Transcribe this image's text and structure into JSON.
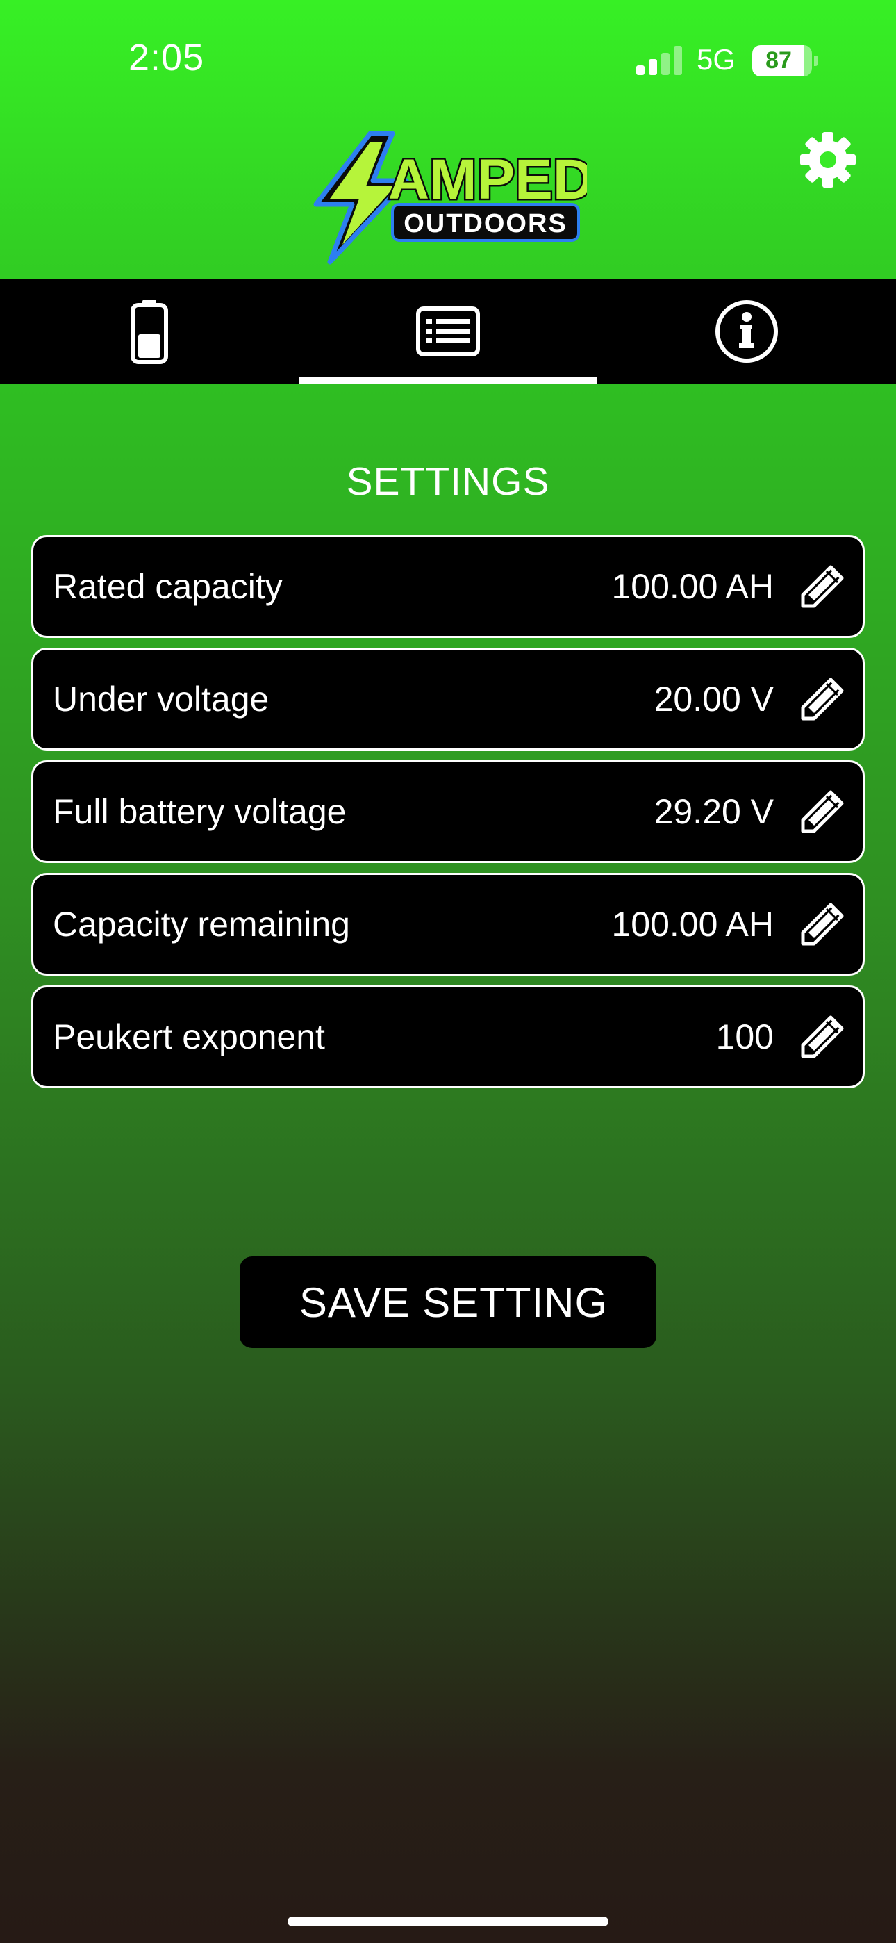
{
  "status_bar": {
    "time": "2:05",
    "network": "5G",
    "battery_percent": "87",
    "battery_level": 0.87,
    "signal_bars_active": 2,
    "signal_bars_total": 4
  },
  "header": {
    "logo_primary": "AMPED",
    "logo_secondary": "OUTDOORS",
    "settings_icon": "gear-icon"
  },
  "tabs": [
    {
      "icon": "battery-icon",
      "active": false
    },
    {
      "icon": "list-icon",
      "active": true
    },
    {
      "icon": "info-icon",
      "active": false
    }
  ],
  "page": {
    "title": "SETTINGS"
  },
  "settings": [
    {
      "label": "Rated capacity",
      "value": "100.00 AH",
      "icon": "pencil-icon"
    },
    {
      "label": "Under voltage",
      "value": "20.00 V",
      "icon": "pencil-icon"
    },
    {
      "label": "Full battery voltage",
      "value": "29.20 V",
      "icon": "pencil-icon"
    },
    {
      "label": "Capacity remaining",
      "value": "100.00 AH",
      "icon": "pencil-icon"
    },
    {
      "label": "Peukert exponent",
      "value": "100",
      "icon": "pencil-icon"
    }
  ],
  "actions": {
    "save_label": "SAVE SETTING"
  },
  "colors": {
    "brand_green": "#37f025",
    "logo_lime": "#b6f43a",
    "logo_blue": "#2d7ff0",
    "bar_black": "#000000"
  }
}
